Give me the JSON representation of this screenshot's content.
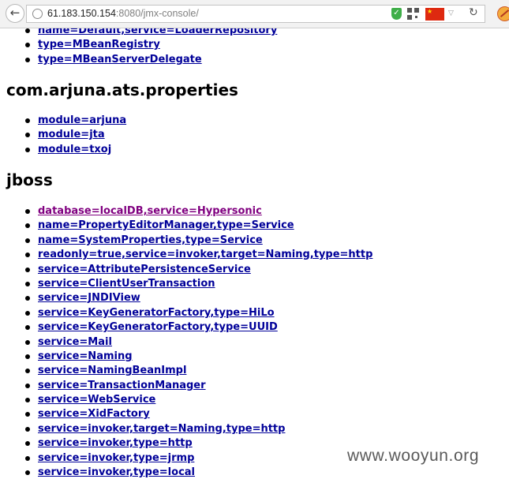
{
  "browser": {
    "back_icon": "arrow-left-icon",
    "url_host": "61.183.150.154",
    "url_rest": ":8080/jmx-console/",
    "shield_symbol": "✓",
    "refresh_symbol": "↻",
    "dropdown_symbol": "▽",
    "flag_star": "★"
  },
  "sections": {
    "top": {
      "items": [
        {
          "label": "name=Default,service=LoaderRepository"
        },
        {
          "label": "type=MBeanRegistry"
        },
        {
          "label": "type=MBeanServerDelegate"
        }
      ]
    },
    "arjuna": {
      "title": "com.arjuna.ats.properties",
      "items": [
        {
          "label": "module=arjuna"
        },
        {
          "label": "module=jta"
        },
        {
          "label": "module=txoj"
        }
      ]
    },
    "jboss": {
      "title": "jboss",
      "items": [
        {
          "label": "database=localDB,service=Hypersonic"
        },
        {
          "label": "name=PropertyEditorManager,type=Service"
        },
        {
          "label": "name=SystemProperties,type=Service"
        },
        {
          "label": "readonly=true,service=invoker,target=Naming,type=http"
        },
        {
          "label": "service=AttributePersistenceService"
        },
        {
          "label": "service=ClientUserTransaction"
        },
        {
          "label": "service=JNDIView"
        },
        {
          "label": "service=KeyGeneratorFactory,type=HiLo"
        },
        {
          "label": "service=KeyGeneratorFactory,type=UUID"
        },
        {
          "label": "service=Mail"
        },
        {
          "label": "service=Naming"
        },
        {
          "label": "service=NamingBeanImpl"
        },
        {
          "label": "service=TransactionManager"
        },
        {
          "label": "service=WebService"
        },
        {
          "label": "service=XidFactory"
        },
        {
          "label": "service=invoker,target=Naming,type=http"
        },
        {
          "label": "service=invoker,type=http"
        },
        {
          "label": "service=invoker,type=jrmp"
        },
        {
          "label": "service=invoker,type=local"
        }
      ]
    }
  },
  "watermark": "www.wooyun.org",
  "colors": {
    "link": "#000099",
    "visited_link": "#800080"
  }
}
